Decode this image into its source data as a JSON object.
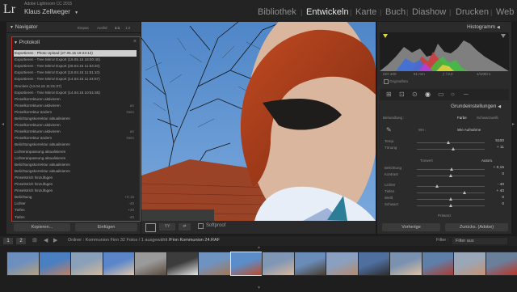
{
  "app": {
    "logo": "Lr",
    "name": "Adobe Lightroom CC 2015",
    "user": "Klaus Zellweger",
    "user_arrow": "▼"
  },
  "modules": [
    {
      "label": "Bibliothek",
      "active": false
    },
    {
      "label": "Entwickeln",
      "active": true
    },
    {
      "label": "Karte",
      "active": false
    },
    {
      "label": "Buch",
      "active": false
    },
    {
      "label": "Diashow",
      "active": false
    },
    {
      "label": "Drucken",
      "active": false
    },
    {
      "label": "Web",
      "active": false
    }
  ],
  "navigator": {
    "title": "Navigator",
    "zoom_options": [
      "Einpas",
      "Ausfül",
      "1:1",
      "1:2"
    ]
  },
  "history": {
    "title": "Protokoll",
    "close": "×",
    "items": [
      {
        "name": "Exportieren - Photo Upload (27.05.15 19:23:12)",
        "value": "",
        "selected": true
      },
      {
        "name": "Exportieren - Tree Mirror Export (16.05.15 18:00:40)",
        "value": "",
        "selected": false
      },
      {
        "name": "Exportieren - Tree Mirror Export (26.04.15 11:53:20)",
        "value": "",
        "selected": false
      },
      {
        "name": "Exportieren - Tree Mirror Export (16.04.15 11:51:10)",
        "value": "",
        "selected": false
      },
      {
        "name": "Exportieren - Tree Mirror Export (14.04.15 11:24:57)",
        "value": "",
        "selected": false
      },
      {
        "name": "Drucken (14.04.15 11:01:27)",
        "value": "",
        "selected": false
      },
      {
        "name": "Exportieren - Tree Mirror Export (14.04.15 10:51:55)",
        "value": "",
        "selected": false
      },
      {
        "name": "Pinselkorrekturen aktivieren",
        "value": "",
        "selected": false
      },
      {
        "name": "Pinselkorrekturen aktivieren",
        "value": "an",
        "selected": false
      },
      {
        "name": "Pinselkorrektur ändern",
        "value": "Nein",
        "selected": false
      },
      {
        "name": "Belichtungskorrektur aktualisieren",
        "value": "",
        "selected": false
      },
      {
        "name": "Pinselkorrekturen aktivieren",
        "value": "",
        "selected": false
      },
      {
        "name": "Pinselkorrekturen aktivieren",
        "value": "an",
        "selected": false
      },
      {
        "name": "Pinselkorrektur ändern",
        "value": "Nein",
        "selected": false
      },
      {
        "name": "Belichtungskorrektur aktualisieren",
        "value": "",
        "selected": false
      },
      {
        "name": "Lichteranpassung aktualisieren",
        "value": "",
        "selected": false
      },
      {
        "name": "Lichteranpassung aktualisieren",
        "value": "",
        "selected": false
      },
      {
        "name": "Belichtungskorrektur aktualisieren",
        "value": "",
        "selected": false
      },
      {
        "name": "Belichtungskorrektur aktualisieren",
        "value": "",
        "selected": false
      },
      {
        "name": "Pinselstrich hinzufügen",
        "value": "",
        "selected": false
      },
      {
        "name": "Pinselstrich hinzufügen",
        "value": "",
        "selected": false
      },
      {
        "name": "Pinselstrich hinzufügen",
        "value": "",
        "selected": false
      },
      {
        "name": "Belichtung",
        "value": "+0.15",
        "selected": false
      },
      {
        "name": "Lichter",
        "value": "-40",
        "selected": false
      },
      {
        "name": "Tiefen",
        "value": "+40",
        "selected": false
      },
      {
        "name": "Tiefen",
        "value": "-40",
        "selected": false
      }
    ]
  },
  "left_buttons": {
    "copy": "Kopieren...",
    "paste": "Einfügen"
  },
  "toolbar": {
    "softproof": "Softproof"
  },
  "histogram": {
    "title": "Histogramm",
    "iso": "ISO 400",
    "focal": "51 mm",
    "aperture": "ƒ / 8,0",
    "shutter": "1/1000 s",
    "original_label": "Originalfoto"
  },
  "basic": {
    "title": "Grundeinstellungen",
    "treatment_label": "Behandlung :",
    "color_label": "Farbe",
    "bw_label": "Schwarzweiß",
    "wb_label": "WA :",
    "wb_value": "Wie Aufnahme",
    "tone_label": "Tonwert",
    "auto_label": "Autom.",
    "presence_label": "Präsenz",
    "sliders": [
      {
        "label": "Temp.",
        "value": "5100",
        "pos": 0.47
      },
      {
        "label": "Tönung",
        "value": "+ 11",
        "pos": 0.53
      },
      {
        "label": "Belichtung",
        "value": "+ 0,15",
        "pos": 0.51
      },
      {
        "label": "Kontrast",
        "value": "0",
        "pos": 0.5
      },
      {
        "label": "Lichter",
        "value": "- 40",
        "pos": 0.3
      },
      {
        "label": "Tiefen",
        "value": "+ 40",
        "pos": 0.7
      },
      {
        "label": "Weiß",
        "value": "0",
        "pos": 0.5
      },
      {
        "label": "Schwarz",
        "value": "0",
        "pos": 0.5
      }
    ]
  },
  "right_buttons": {
    "previous": "Vorherige",
    "reset": "Zurücks. (Adobe)"
  },
  "filmbar": {
    "page1": "1",
    "page2": "2",
    "info_prefix": "Ordner : Kommunion Finn",
    "info_count": "32 Fotos / 1 ausgewählt",
    "info_file": "/Finn Kommunion 24.RAF",
    "filter_label": "Filter :",
    "filter_value": "Filter aus"
  },
  "colors": {
    "accent_red": "#c8312a",
    "active_module": "#e8e8e8",
    "panel_bg": "#2b2b2b",
    "sky": "#5b8dc9"
  },
  "filmstrip_count": 16
}
